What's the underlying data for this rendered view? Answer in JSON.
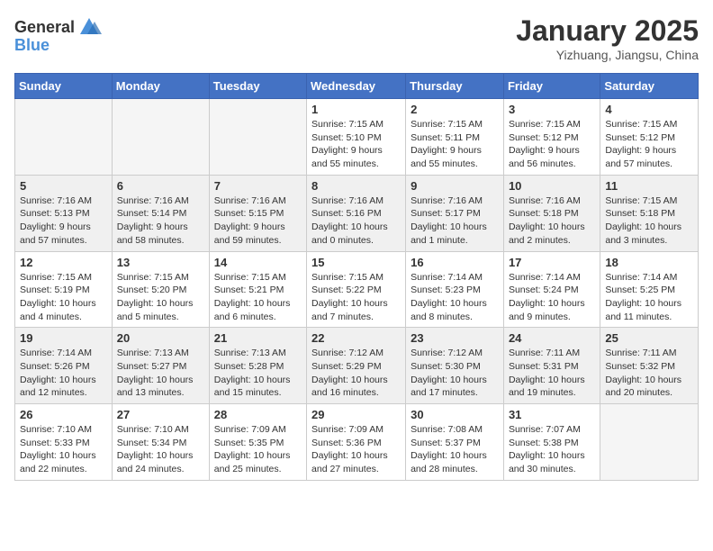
{
  "header": {
    "logo_general": "General",
    "logo_blue": "Blue",
    "month": "January 2025",
    "location": "Yizhuang, Jiangsu, China"
  },
  "weekdays": [
    "Sunday",
    "Monday",
    "Tuesday",
    "Wednesday",
    "Thursday",
    "Friday",
    "Saturday"
  ],
  "weeks": [
    [
      {
        "day": "",
        "info": ""
      },
      {
        "day": "",
        "info": ""
      },
      {
        "day": "",
        "info": ""
      },
      {
        "day": "1",
        "info": "Sunrise: 7:15 AM\nSunset: 5:10 PM\nDaylight: 9 hours\nand 55 minutes."
      },
      {
        "day": "2",
        "info": "Sunrise: 7:15 AM\nSunset: 5:11 PM\nDaylight: 9 hours\nand 55 minutes."
      },
      {
        "day": "3",
        "info": "Sunrise: 7:15 AM\nSunset: 5:12 PM\nDaylight: 9 hours\nand 56 minutes."
      },
      {
        "day": "4",
        "info": "Sunrise: 7:15 AM\nSunset: 5:12 PM\nDaylight: 9 hours\nand 57 minutes."
      }
    ],
    [
      {
        "day": "5",
        "info": "Sunrise: 7:16 AM\nSunset: 5:13 PM\nDaylight: 9 hours\nand 57 minutes."
      },
      {
        "day": "6",
        "info": "Sunrise: 7:16 AM\nSunset: 5:14 PM\nDaylight: 9 hours\nand 58 minutes."
      },
      {
        "day": "7",
        "info": "Sunrise: 7:16 AM\nSunset: 5:15 PM\nDaylight: 9 hours\nand 59 minutes."
      },
      {
        "day": "8",
        "info": "Sunrise: 7:16 AM\nSunset: 5:16 PM\nDaylight: 10 hours\nand 0 minutes."
      },
      {
        "day": "9",
        "info": "Sunrise: 7:16 AM\nSunset: 5:17 PM\nDaylight: 10 hours\nand 1 minute."
      },
      {
        "day": "10",
        "info": "Sunrise: 7:16 AM\nSunset: 5:18 PM\nDaylight: 10 hours\nand 2 minutes."
      },
      {
        "day": "11",
        "info": "Sunrise: 7:15 AM\nSunset: 5:18 PM\nDaylight: 10 hours\nand 3 minutes."
      }
    ],
    [
      {
        "day": "12",
        "info": "Sunrise: 7:15 AM\nSunset: 5:19 PM\nDaylight: 10 hours\nand 4 minutes."
      },
      {
        "day": "13",
        "info": "Sunrise: 7:15 AM\nSunset: 5:20 PM\nDaylight: 10 hours\nand 5 minutes."
      },
      {
        "day": "14",
        "info": "Sunrise: 7:15 AM\nSunset: 5:21 PM\nDaylight: 10 hours\nand 6 minutes."
      },
      {
        "day": "15",
        "info": "Sunrise: 7:15 AM\nSunset: 5:22 PM\nDaylight: 10 hours\nand 7 minutes."
      },
      {
        "day": "16",
        "info": "Sunrise: 7:14 AM\nSunset: 5:23 PM\nDaylight: 10 hours\nand 8 minutes."
      },
      {
        "day": "17",
        "info": "Sunrise: 7:14 AM\nSunset: 5:24 PM\nDaylight: 10 hours\nand 9 minutes."
      },
      {
        "day": "18",
        "info": "Sunrise: 7:14 AM\nSunset: 5:25 PM\nDaylight: 10 hours\nand 11 minutes."
      }
    ],
    [
      {
        "day": "19",
        "info": "Sunrise: 7:14 AM\nSunset: 5:26 PM\nDaylight: 10 hours\nand 12 minutes."
      },
      {
        "day": "20",
        "info": "Sunrise: 7:13 AM\nSunset: 5:27 PM\nDaylight: 10 hours\nand 13 minutes."
      },
      {
        "day": "21",
        "info": "Sunrise: 7:13 AM\nSunset: 5:28 PM\nDaylight: 10 hours\nand 15 minutes."
      },
      {
        "day": "22",
        "info": "Sunrise: 7:12 AM\nSunset: 5:29 PM\nDaylight: 10 hours\nand 16 minutes."
      },
      {
        "day": "23",
        "info": "Sunrise: 7:12 AM\nSunset: 5:30 PM\nDaylight: 10 hours\nand 17 minutes."
      },
      {
        "day": "24",
        "info": "Sunrise: 7:11 AM\nSunset: 5:31 PM\nDaylight: 10 hours\nand 19 minutes."
      },
      {
        "day": "25",
        "info": "Sunrise: 7:11 AM\nSunset: 5:32 PM\nDaylight: 10 hours\nand 20 minutes."
      }
    ],
    [
      {
        "day": "26",
        "info": "Sunrise: 7:10 AM\nSunset: 5:33 PM\nDaylight: 10 hours\nand 22 minutes."
      },
      {
        "day": "27",
        "info": "Sunrise: 7:10 AM\nSunset: 5:34 PM\nDaylight: 10 hours\nand 24 minutes."
      },
      {
        "day": "28",
        "info": "Sunrise: 7:09 AM\nSunset: 5:35 PM\nDaylight: 10 hours\nand 25 minutes."
      },
      {
        "day": "29",
        "info": "Sunrise: 7:09 AM\nSunset: 5:36 PM\nDaylight: 10 hours\nand 27 minutes."
      },
      {
        "day": "30",
        "info": "Sunrise: 7:08 AM\nSunset: 5:37 PM\nDaylight: 10 hours\nand 28 minutes."
      },
      {
        "day": "31",
        "info": "Sunrise: 7:07 AM\nSunset: 5:38 PM\nDaylight: 10 hours\nand 30 minutes."
      },
      {
        "day": "",
        "info": ""
      }
    ]
  ]
}
